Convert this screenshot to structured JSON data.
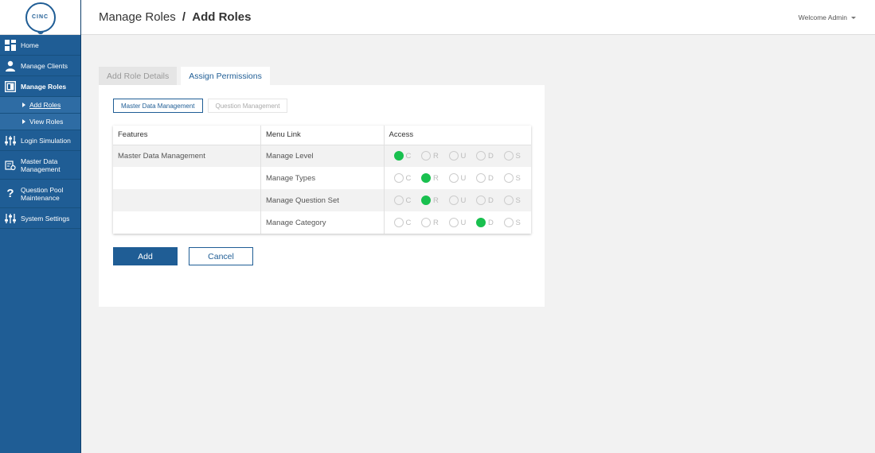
{
  "sidebar": {
    "logo_text": "CINC",
    "items": [
      {
        "label": "Home",
        "icon": "dashboard-icon"
      },
      {
        "label": "Manage Clients",
        "icon": "user-icon"
      },
      {
        "label": "Manage Roles",
        "icon": "roles-icon"
      },
      {
        "label": "Login Simulation",
        "icon": "sliders-icon"
      },
      {
        "label": "Master Data Management",
        "icon": "data-settings-icon"
      },
      {
        "label": "Question Pool Maintenance",
        "icon": "question-icon"
      },
      {
        "label": "System Settings",
        "icon": "sliders-icon"
      }
    ],
    "sub_items": [
      {
        "label": "Add Roles"
      },
      {
        "label": "View Roles"
      }
    ]
  },
  "header": {
    "breadcrumb_parent": "Manage Roles",
    "breadcrumb_sep": "/",
    "breadcrumb_current": "Add Roles",
    "welcome": "Welcome Admin"
  },
  "tabs": [
    {
      "label": "Add Role Details",
      "active": false
    },
    {
      "label": "Assign Permissions",
      "active": true
    }
  ],
  "subtabs": [
    {
      "label": "Master Data Management",
      "active": true
    },
    {
      "label": "Question Management",
      "active": false
    }
  ],
  "table": {
    "headers": [
      "Features",
      "Menu Link",
      "Access"
    ],
    "access_options": [
      "C",
      "R",
      "U",
      "D",
      "S"
    ],
    "rows": [
      {
        "feature": "Master Data Management",
        "menu_link": "Manage Level",
        "selected": "C"
      },
      {
        "feature": "",
        "menu_link": "Manage Types",
        "selected": "R"
      },
      {
        "feature": "",
        "menu_link": "Manage Question Set",
        "selected": "R"
      },
      {
        "feature": "",
        "menu_link": "Manage Category",
        "selected": "D"
      }
    ]
  },
  "buttons": {
    "add": "Add",
    "cancel": "Cancel"
  },
  "colors": {
    "primary": "#1f5d95",
    "selected_radio": "#19c04f"
  }
}
